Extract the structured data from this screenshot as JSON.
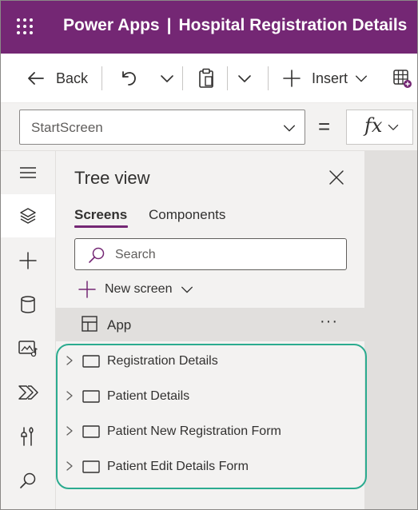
{
  "header": {
    "app_name": "Power Apps",
    "separator": "|",
    "app_title": "Hospital Registration Details",
    "waffle_icon": "waffle-icon",
    "bg_color": "#742774"
  },
  "command_bar": {
    "back_label": "Back",
    "insert_label": "Insert",
    "icons": [
      "arrow-left-icon",
      "undo-icon",
      "chevron-down-icon",
      "paste-icon",
      "chevron-down-icon",
      "plus-icon",
      "chevron-down-icon",
      "add-table-icon"
    ]
  },
  "formula_bar": {
    "property_value": "StartScreen",
    "equals": "=",
    "fx_label": "fx"
  },
  "left_rail": {
    "items": [
      "hamburger-icon",
      "layers-icon",
      "plus-icon",
      "database-icon",
      "media-icon",
      "power-automate-icon",
      "tools-icon",
      "search-icon"
    ],
    "active": "layers-icon"
  },
  "tree_view": {
    "title": "Tree view",
    "tabs": [
      {
        "label": "Screens",
        "active": true
      },
      {
        "label": "Components",
        "active": false
      }
    ],
    "search_placeholder": "Search",
    "new_screen_label": "New screen",
    "app_node": {
      "label": "App",
      "more": "···"
    },
    "screens": [
      {
        "label": "Registration Details"
      },
      {
        "label": "Patient Details"
      },
      {
        "label": "Patient New Registration Form"
      },
      {
        "label": "Patient Edit Details Form"
      }
    ]
  },
  "colors": {
    "accent": "#742774",
    "highlight": "#2bab8f"
  }
}
